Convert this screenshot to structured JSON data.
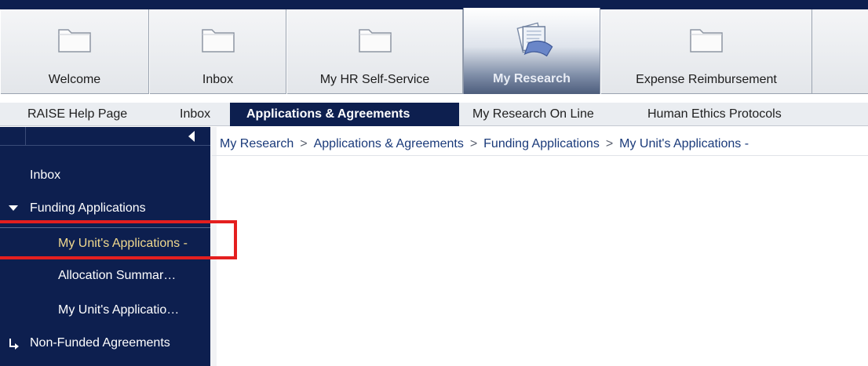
{
  "launchpad": {
    "tiles": [
      {
        "label": "Welcome",
        "icon": "folder-icon"
      },
      {
        "label": "Inbox",
        "icon": "folder-icon"
      },
      {
        "label": "My HR Self-Service",
        "icon": "folder-icon"
      },
      {
        "label": "My Research",
        "icon": "documents-icon",
        "active": true
      },
      {
        "label": "Expense Reimbursement",
        "icon": "folder-icon"
      }
    ]
  },
  "subnav": {
    "tabs": [
      {
        "label": "RAISE Help Page"
      },
      {
        "label": "Inbox"
      },
      {
        "label": "Applications & Agreements",
        "active": true
      },
      {
        "label": "My Research On Line"
      },
      {
        "label": "Human Ethics Protocols"
      }
    ]
  },
  "sidebar": {
    "items": [
      {
        "label": "Inbox"
      },
      {
        "label": "Funding Applications",
        "expanded": true
      },
      {
        "label": "My Unit's Applications -",
        "selected": true
      },
      {
        "label": "Allocation Summar…"
      },
      {
        "label": "My Unit's Applicatio…"
      },
      {
        "label": "Non-Funded Agreements"
      }
    ]
  },
  "breadcrumb": {
    "parts": [
      "My Research",
      "Applications & Agreements",
      "Funding Applications",
      "My Unit's Applications -"
    ]
  },
  "colors": {
    "navy": "#0d1f4f",
    "selected_text": "#f1d98e",
    "highlight": "#e41f1f",
    "crumb_link": "#1a3a7a"
  }
}
